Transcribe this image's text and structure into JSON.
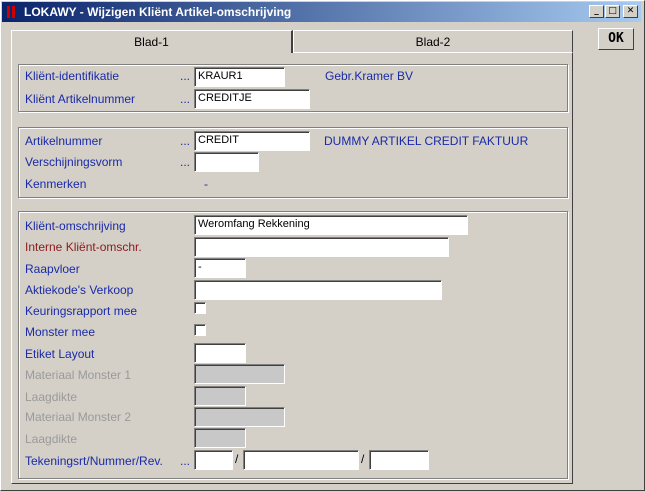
{
  "window": {
    "title": "LOKAWY - Wijzigen Kliënt Artikel-omschrijving",
    "min": "_",
    "max": "□",
    "close": "✕"
  },
  "ok_label": "OK",
  "tabs": [
    "Blad-1",
    "Blad-2"
  ],
  "group1": {
    "client_id_label": "Kliënt-identifikatie",
    "client_id_value": "KRAUR1",
    "client_name": "Gebr.Kramer BV",
    "client_art_label": "Kliënt Artikelnummer",
    "client_art_value": "CREDITJE",
    "dots": "..."
  },
  "group2": {
    "art_label": "Artikelnummer",
    "art_value": "CREDIT",
    "art_desc": "DUMMY ARTIKEL CREDIT FAKTUUR",
    "form_label": "Verschijningsvorm",
    "form_value": "",
    "marks_label": "Kenmerken",
    "marks_value": "-",
    "dots": "..."
  },
  "group3": {
    "desc_label": "Kliënt-omschrijving",
    "desc_value": "Weromfang Rekkening",
    "internal_label": "Interne Kliënt-omschr.",
    "internal_value": "",
    "floor_label": "Raapvloer",
    "floor_value": "-",
    "action_label": "Aktiekode's Verkoop",
    "action_value": "",
    "report_label": "Keuringsrapport mee",
    "sample_label": "Monster mee",
    "etiket_label": "Etiket Layout",
    "etiket_value": "",
    "mat1_label": "Materiaal Monster 1",
    "layer1_label": "Laagdikte",
    "mat2_label": "Materiaal Monster 2",
    "layer2_label": "Laagdikte",
    "drawing_label": "Tekeningsrt/Nummer/Rev.",
    "dots": "...",
    "slash": "/"
  }
}
